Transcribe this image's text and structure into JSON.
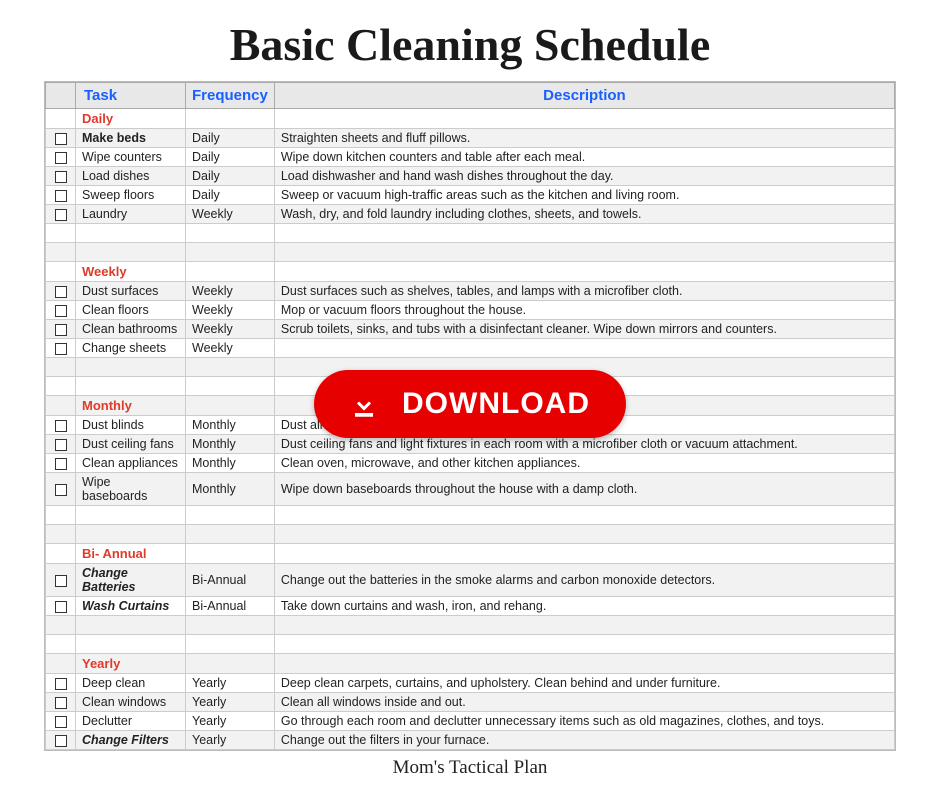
{
  "title": "Basic Cleaning Schedule",
  "footer": "Mom's Tactical Plan",
  "download_label": "DOWNLOAD",
  "headers": {
    "task": "Task",
    "frequency": "Frequency",
    "description": "Description"
  },
  "sections": [
    {
      "name": "Daily",
      "rows": [
        {
          "task": "Make beds",
          "freq": "Daily",
          "desc": "Straighten sheets and fluff pillows.",
          "bold": true
        },
        {
          "task": "Wipe counters",
          "freq": "Daily",
          "desc": "Wipe down kitchen counters and table after each meal."
        },
        {
          "task": "Load dishes",
          "freq": "Daily",
          "desc": "Load dishwasher and hand wash dishes throughout the day."
        },
        {
          "task": "Sweep floors",
          "freq": "Daily",
          "desc": "Sweep or vacuum high-traffic areas such as the kitchen and living room."
        },
        {
          "task": "Laundry",
          "freq": "Weekly",
          "desc": "Wash, dry, and fold laundry including clothes, sheets, and towels."
        }
      ],
      "spacer_after": 2
    },
    {
      "name": "Weekly",
      "rows": [
        {
          "task": "Dust surfaces",
          "freq": "Weekly",
          "desc": "Dust surfaces such as shelves, tables, and lamps with a microfiber cloth."
        },
        {
          "task": "Clean floors",
          "freq": "Weekly",
          "desc": "Mop or vacuum floors throughout the house."
        },
        {
          "task": "Clean bathrooms",
          "freq": "Weekly",
          "desc": "Scrub toilets, sinks, and tubs with a disinfectant cleaner. Wipe down mirrors and counters."
        },
        {
          "task": "Change sheets",
          "freq": "Weekly",
          "desc": ""
        }
      ],
      "spacer_after": 2
    },
    {
      "name": "Monthly",
      "rows": [
        {
          "task": "Dust blinds",
          "freq": "Monthly",
          "desc": "Dust all window blinds with a microfiber cloth."
        },
        {
          "task": "Dust ceiling fans",
          "freq": "Monthly",
          "desc": "Dust ceiling fans and light fixtures in each room with a microfiber cloth or vacuum attachment."
        },
        {
          "task": "Clean appliances",
          "freq": "Monthly",
          "desc": "Clean oven, microwave, and other kitchen appliances."
        },
        {
          "task": "Wipe baseboards",
          "freq": "Monthly",
          "desc": "Wipe down baseboards throughout the house with a damp cloth."
        }
      ],
      "spacer_after": 2
    },
    {
      "name": "Bi- Annual",
      "rows": [
        {
          "task": "Change Batteries",
          "freq": "Bi-Annual",
          "desc": "Change out the batteries in the smoke alarms and carbon monoxide detectors.",
          "italic": true
        },
        {
          "task": "Wash Curtains",
          "freq": "Bi-Annual",
          "desc": "Take down curtains and wash, iron, and rehang.",
          "italic": true
        }
      ],
      "spacer_after": 2
    },
    {
      "name": "Yearly",
      "rows": [
        {
          "task": "Deep clean",
          "freq": "Yearly",
          "desc": "Deep clean carpets, curtains, and upholstery. Clean behind and under furniture."
        },
        {
          "task": "Clean windows",
          "freq": "Yearly",
          "desc": "Clean all windows inside and out."
        },
        {
          "task": "Declutter",
          "freq": "Yearly",
          "desc": "Go through each room and declutter unnecessary items such as old magazines, clothes, and toys."
        },
        {
          "task": "Change Filters",
          "freq": "Yearly",
          "desc": "Change out the filters in your furnace.",
          "italic": true
        }
      ],
      "spacer_after": 0
    }
  ]
}
